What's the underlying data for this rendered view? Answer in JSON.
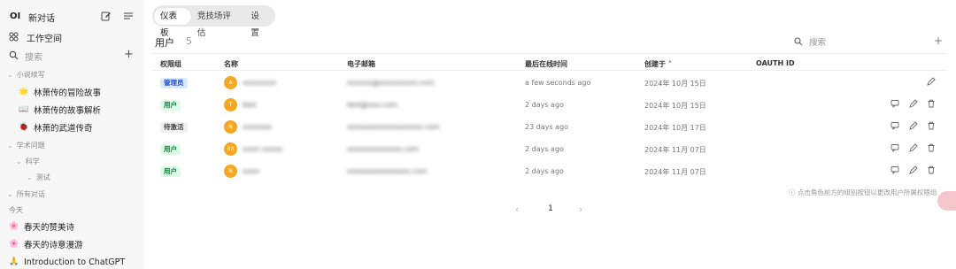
{
  "sidebar": {
    "logo": "OI",
    "new_chat": "新对话",
    "workspace": "工作空间",
    "search": "搜索",
    "folders": [
      {
        "label": "小说续写",
        "items": [
          {
            "emoji": "🌟",
            "title": "林萧传的冒险故事"
          },
          {
            "emoji": "📖",
            "title": "林萧传的故事解析"
          },
          {
            "emoji": "🐞",
            "title": "林萧的武道传奇"
          }
        ]
      },
      {
        "label": "学术问题"
      },
      {
        "label": "科学"
      },
      {
        "label": "测试"
      },
      {
        "label": "所有对话"
      }
    ],
    "today_label": "今天",
    "recent": [
      {
        "emoji": "🌸",
        "title": "春天的赞美诗"
      },
      {
        "emoji": "🌸",
        "title": "春天的诗意漫游"
      },
      {
        "emoji": "🙏",
        "title": "Introduction to ChatGPT"
      }
    ]
  },
  "tabs": [
    "仪表板",
    "竞技场评估",
    "设置"
  ],
  "main": {
    "title": "用户",
    "count": "5",
    "search_placeholder": "搜索",
    "plus": "+",
    "columns": [
      "权限组",
      "名称",
      "电子邮箱",
      "最后在线时间",
      "创建于 ˄",
      "OAUTH ID"
    ],
    "rows": [
      {
        "role": "管理员",
        "role_type": "admin",
        "avatar": "A",
        "name": "xxxxxxxx",
        "email": "xxxxxx@xxxxxxxxx.com",
        "last_active": "a few seconds ago",
        "created": "2024年 10月 15日"
      },
      {
        "role": "用户",
        "role_type": "user",
        "avatar": "T",
        "name": "test",
        "email": "test@xxx.com",
        "last_active": "2 days ago",
        "created": "2024年 10月 15日"
      },
      {
        "role": "待激活",
        "role_type": "pending",
        "avatar": "N",
        "name": "xxxxxxx",
        "email": "xxxxxxxxxxxxxxxxxx.com",
        "last_active": "23 days ago",
        "created": "2024年 10月 17日"
      },
      {
        "role": "用户",
        "role_type": "user",
        "avatar": "BX",
        "name": "xxxx xxxxx",
        "email": "xxxxxxxxxxxxx.com",
        "last_active": "2 days ago",
        "created": "2024年 11月 07日"
      },
      {
        "role": "用户",
        "role_type": "user",
        "avatar": "N",
        "name": "xxxx",
        "email": "xxxxxxxxxxxxxxx.com",
        "last_active": "2 days ago",
        "created": "2024年 11月 07日"
      }
    ],
    "note": "点击角色前方的组别按钮以更改用户所属权限组",
    "page": "1",
    "prev": "‹",
    "next": "›"
  }
}
